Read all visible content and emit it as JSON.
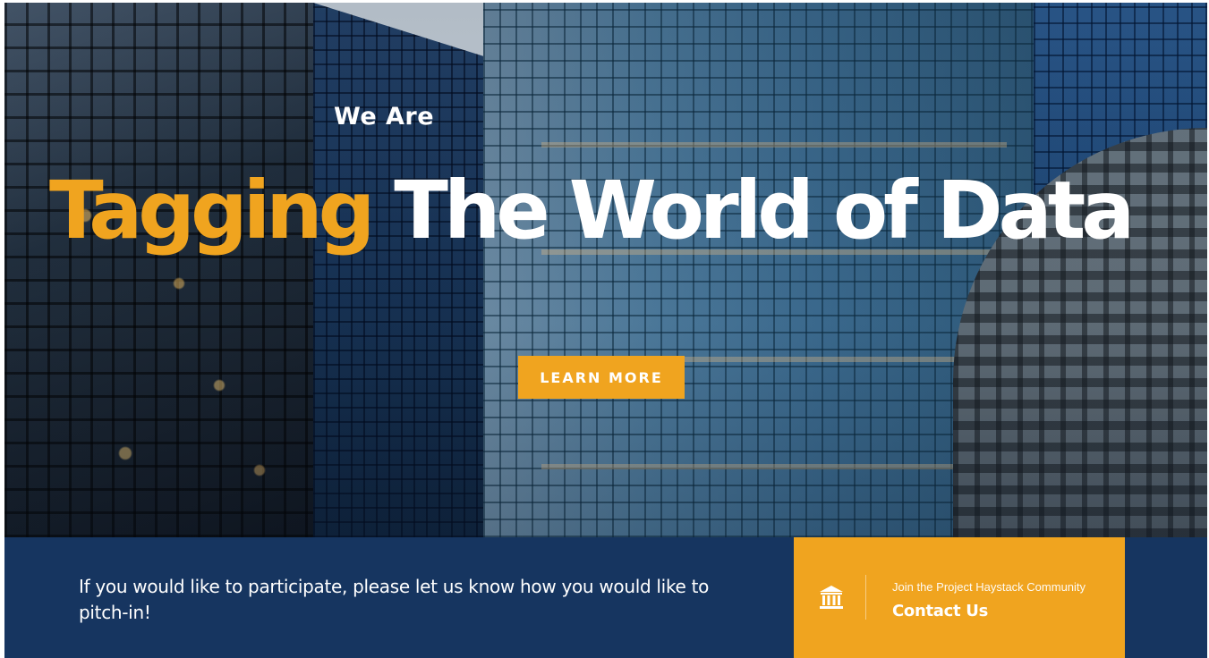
{
  "hero": {
    "kicker": "We Are",
    "headline_accent": "Tagging",
    "headline_rest": "The World of Data",
    "cta_label": "LEARN MORE",
    "background": "city-skyscrapers-image"
  },
  "band": {
    "message": "If you would like to participate, please let us know how you would like to pitch-in!",
    "contact": {
      "icon": "bank-building-icon",
      "subtitle": "Join the Project Haystack Community",
      "label": "Contact Us"
    }
  },
  "colors": {
    "accent": "#f0a41f",
    "navy": "#163560",
    "text": "#ffffff"
  }
}
